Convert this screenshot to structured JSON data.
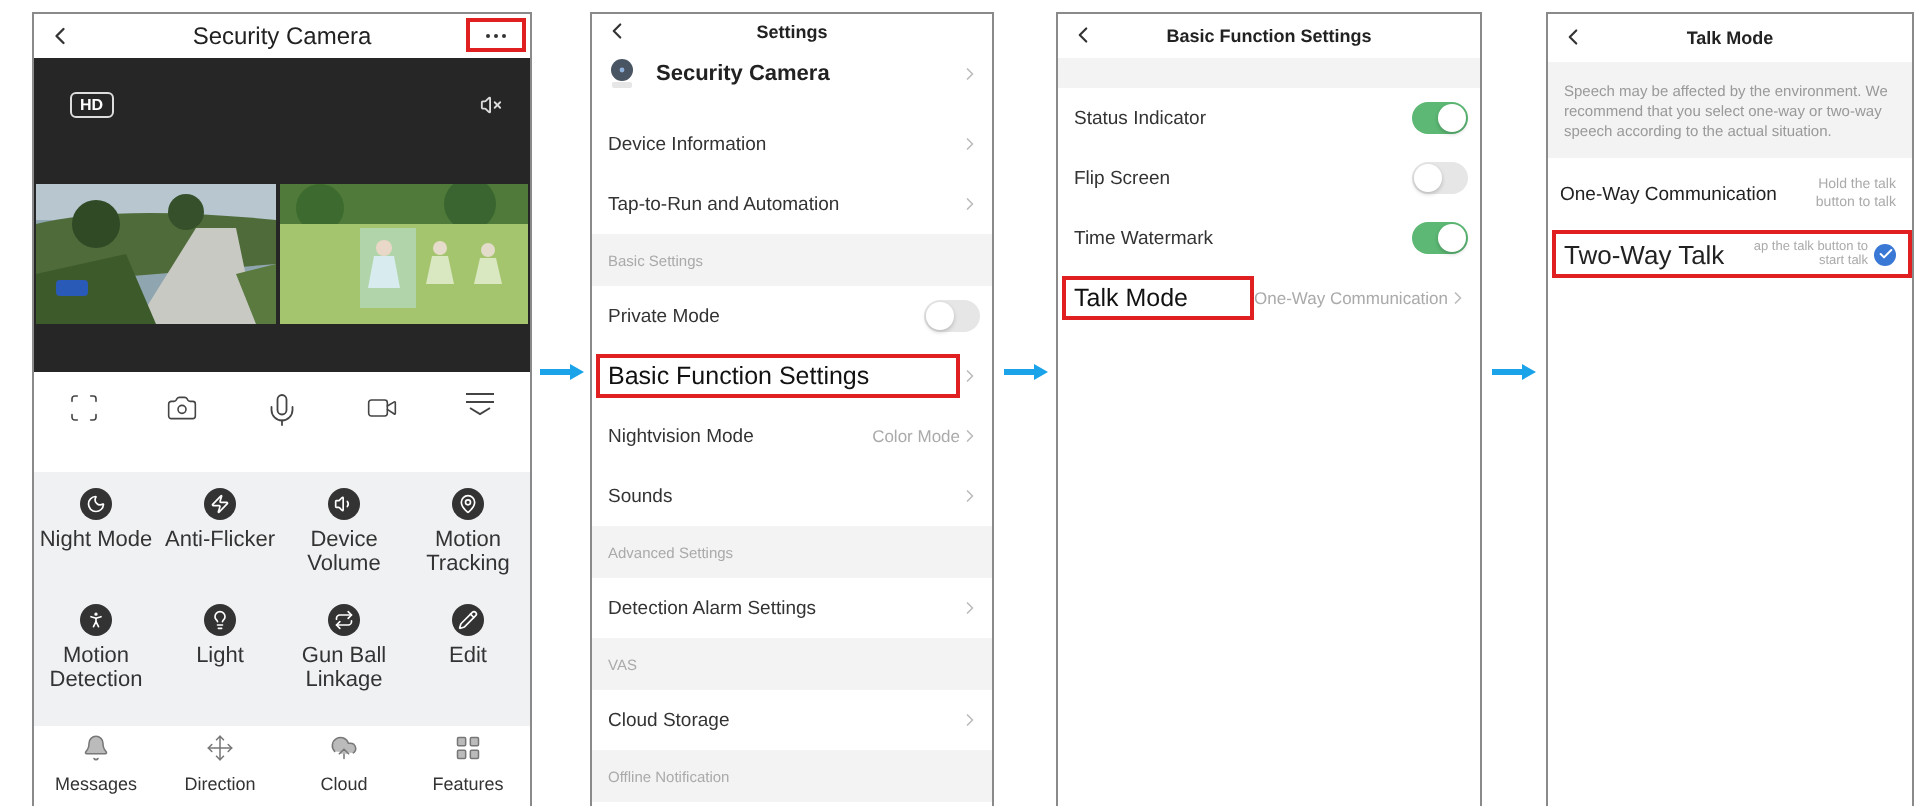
{
  "screens": [
    {
      "kind": "live_view",
      "title": "Security Camera",
      "menu_highlighted": true,
      "badge": "HD",
      "features": [
        {
          "label": "Night Mode"
        },
        {
          "label": "Anti-Flicker"
        },
        {
          "label": "Device Volume"
        },
        {
          "label": "Motion Tracking"
        },
        {
          "label": "Motion Detection"
        },
        {
          "label": "Light"
        },
        {
          "label": "Gun Ball Linkage"
        },
        {
          "label": "Edit"
        }
      ],
      "tabs": [
        {
          "label": "Messages"
        },
        {
          "label": "Direction"
        },
        {
          "label": "Cloud"
        },
        {
          "label": "Features"
        }
      ]
    },
    {
      "kind": "settings",
      "title": "Settings",
      "device_name": "Security Camera",
      "rows": [
        {
          "kind": "link",
          "label": "Device Information",
          "highlighted": false
        },
        {
          "kind": "link",
          "label": "Tap-to-Run and Automation",
          "highlighted": false
        },
        {
          "kind": "section",
          "label": "Basic Settings"
        },
        {
          "kind": "toggle",
          "label": "Private Mode",
          "on": false,
          "highlighted": false
        },
        {
          "kind": "link",
          "label": "Basic Function Settings",
          "highlighted": true
        },
        {
          "kind": "link",
          "label": "Nightvision Mode",
          "value": "Color Mode",
          "highlighted": false
        },
        {
          "kind": "link",
          "label": "Sounds",
          "highlighted": false
        },
        {
          "kind": "section",
          "label": "Advanced Settings"
        },
        {
          "kind": "link",
          "label": "Detection Alarm Settings",
          "highlighted": false
        },
        {
          "kind": "section",
          "label": "VAS"
        },
        {
          "kind": "link",
          "label": "Cloud Storage",
          "highlighted": false
        },
        {
          "kind": "section",
          "label": "Offline Notification"
        }
      ]
    },
    {
      "kind": "settings",
      "title": "Basic Function Settings",
      "rows": [
        {
          "kind": "gap"
        },
        {
          "kind": "toggle",
          "label": "Status Indicator",
          "on": true,
          "highlighted": false
        },
        {
          "kind": "toggle",
          "label": "Flip Screen",
          "on": false,
          "highlighted": false
        },
        {
          "kind": "toggle",
          "label": "Time Watermark",
          "on": true,
          "highlighted": false
        },
        {
          "kind": "link",
          "label": "Talk Mode",
          "value": "One-Way Communication",
          "highlighted": true
        }
      ]
    },
    {
      "kind": "options",
      "title": "Talk Mode",
      "note": "Speech may be affected by the environment. We recommend that you select one-way or two-way speech according to the actual situation.",
      "options": [
        {
          "label": "One-Way Communication",
          "hint": "Hold the talk button to talk",
          "selected": false,
          "highlighted": false
        },
        {
          "label": "Two-Way Talk",
          "hint": "ap the talk button to start talk",
          "selected": true,
          "highlighted": true
        }
      ]
    }
  ]
}
